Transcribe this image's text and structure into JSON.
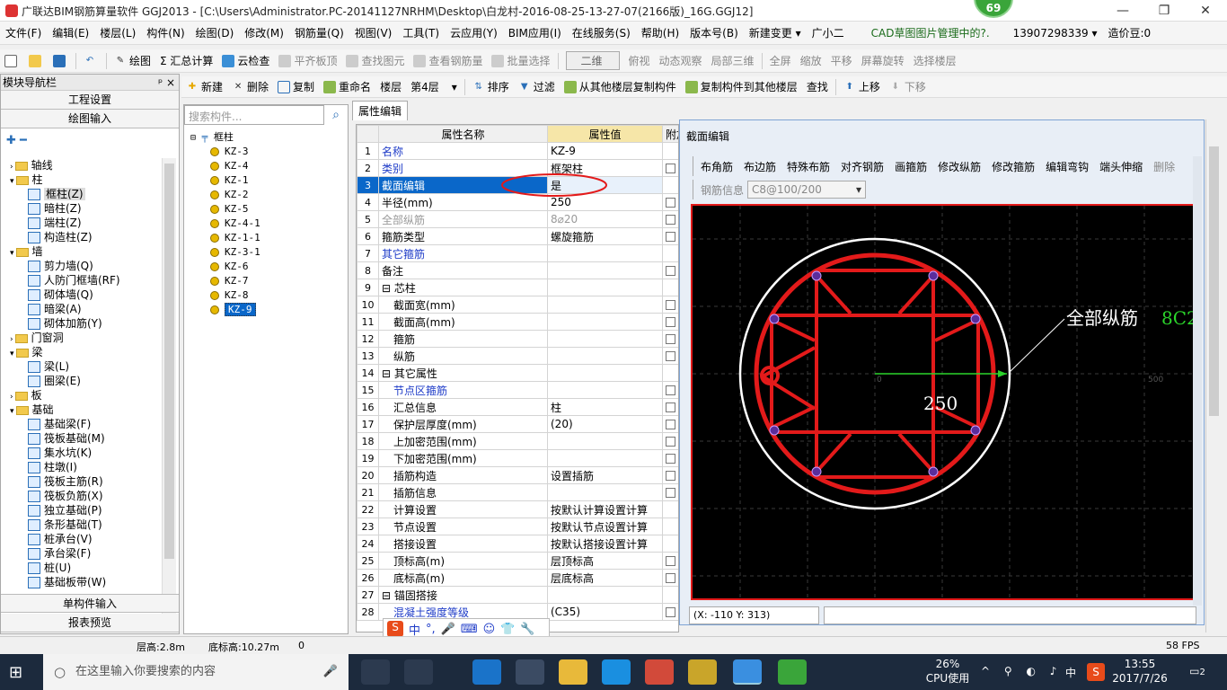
{
  "title_bar": {
    "text": "广联达BIM钢筋算量软件 GGJ2013 - [C:\\Users\\Administrator.PC-20141127NRHM\\Desktop\\白龙村-2016-08-25-13-27-07(2166版)_16G.GGJ12]",
    "badge": "69"
  },
  "menu": [
    "文件(F)",
    "编辑(E)",
    "楼层(L)",
    "构件(N)",
    "绘图(D)",
    "修改(M)",
    "钢筋量(Q)",
    "视图(V)",
    "工具(T)",
    "云应用(Y)",
    "BIM应用(I)",
    "在线服务(S)",
    "帮助(H)",
    "版本号(B)",
    "新建变更 ▾",
    "广小二",
    "CAD草图图片管理中的?.",
    "13907298339 ▾",
    "造价豆:0"
  ],
  "toolbar1": [
    "绘图",
    "Σ 汇总计算",
    "云检查",
    "平齐板顶",
    "查找图元",
    "查看钢筋量",
    "批量选择",
    "二维",
    "俯视",
    "动态观察",
    "局部三维",
    "全屏",
    "缩放",
    "平移",
    "屏幕旋转",
    "选择楼层"
  ],
  "toolbar2": [
    "新建",
    "删除",
    "复制",
    "重命名",
    "楼层",
    "第4层",
    "排序",
    "过滤",
    "从其他楼层复制构件",
    "复制构件到其他楼层",
    "查找",
    "上移",
    "下移"
  ],
  "nav": {
    "header": "模块导航栏",
    "top_buttons": [
      "工程设置",
      "绘图输入"
    ],
    "bottom_buttons": [
      "单构件输入",
      "报表预览"
    ],
    "tree": [
      {
        "label": "轴线",
        "type": "folder",
        "level": 0
      },
      {
        "label": "柱",
        "type": "folder",
        "level": 0
      },
      {
        "label": "框柱(Z)",
        "type": "item",
        "level": 1
      },
      {
        "label": "暗柱(Z)",
        "type": "item",
        "level": 1
      },
      {
        "label": "端柱(Z)",
        "type": "item",
        "level": 1
      },
      {
        "label": "构造柱(Z)",
        "type": "item",
        "level": 1
      },
      {
        "label": "墙",
        "type": "folder",
        "level": 0
      },
      {
        "label": "剪力墙(Q)",
        "type": "item",
        "level": 1
      },
      {
        "label": "人防门框墙(RF)",
        "type": "item",
        "level": 1
      },
      {
        "label": "砌体墙(Q)",
        "type": "item",
        "level": 1
      },
      {
        "label": "暗梁(A)",
        "type": "item",
        "level": 1
      },
      {
        "label": "砌体加筋(Y)",
        "type": "item",
        "level": 1
      },
      {
        "label": "门窗洞",
        "type": "folder",
        "level": 0
      },
      {
        "label": "梁",
        "type": "folder",
        "level": 0
      },
      {
        "label": "梁(L)",
        "type": "item",
        "level": 1
      },
      {
        "label": "圈梁(E)",
        "type": "item",
        "level": 1
      },
      {
        "label": "板",
        "type": "folder",
        "level": 0
      },
      {
        "label": "基础",
        "type": "folder",
        "level": 0
      },
      {
        "label": "基础梁(F)",
        "type": "item",
        "level": 1
      },
      {
        "label": "筏板基础(M)",
        "type": "item",
        "level": 1
      },
      {
        "label": "集水坑(K)",
        "type": "item",
        "level": 1
      },
      {
        "label": "柱墩(I)",
        "type": "item",
        "level": 1
      },
      {
        "label": "筏板主筋(R)",
        "type": "item",
        "level": 1
      },
      {
        "label": "筏板负筋(X)",
        "type": "item",
        "level": 1
      },
      {
        "label": "独立基础(P)",
        "type": "item",
        "level": 1
      },
      {
        "label": "条形基础(T)",
        "type": "item",
        "level": 1
      },
      {
        "label": "桩承台(V)",
        "type": "item",
        "level": 1
      },
      {
        "label": "承台梁(F)",
        "type": "item",
        "level": 1
      },
      {
        "label": "桩(U)",
        "type": "item",
        "level": 1
      },
      {
        "label": "基础板带(W)",
        "type": "item",
        "level": 1
      }
    ]
  },
  "components": {
    "search_placeholder": "搜索构件...",
    "root": "框柱",
    "items": [
      "KZ-3",
      "KZ-4",
      "KZ-1",
      "KZ-2",
      "KZ-5",
      "KZ-4-1",
      "KZ-1-1",
      "KZ-3-1",
      "KZ-6",
      "KZ-7",
      "KZ-8",
      "KZ-9"
    ],
    "selected": "KZ-9"
  },
  "props": {
    "tab": "属性编辑",
    "headers": [
      "属性名称",
      "属性值",
      "附加"
    ],
    "rows": [
      {
        "n": "1",
        "name": "名称",
        "val": "KZ-9",
        "style": "blue",
        "chk": false
      },
      {
        "n": "2",
        "name": "类别",
        "val": "框架柱",
        "style": "blue",
        "chk": true
      },
      {
        "n": "3",
        "name": "截面编辑",
        "val": "是",
        "style": "blue",
        "chk": false,
        "selected": true
      },
      {
        "n": "4",
        "name": "半径(mm)",
        "val": "250",
        "style": "",
        "chk": true
      },
      {
        "n": "5",
        "name": "全部纵筋",
        "val": "8⌀20",
        "style": "gray",
        "chk": true
      },
      {
        "n": "6",
        "name": "箍筋类型",
        "val": "螺旋箍筋",
        "style": "",
        "chk": true
      },
      {
        "n": "7",
        "name": "其它箍筋",
        "val": "",
        "style": "blue",
        "chk": false
      },
      {
        "n": "8",
        "name": "备注",
        "val": "",
        "style": "",
        "chk": true
      },
      {
        "n": "9",
        "name": "⊟ 芯柱",
        "val": "",
        "style": "",
        "chk": false
      },
      {
        "n": "10",
        "name": "截面宽(mm)",
        "val": "",
        "style": "",
        "chk": true,
        "indent": true
      },
      {
        "n": "11",
        "name": "截面高(mm)",
        "val": "",
        "style": "",
        "chk": true,
        "indent": true
      },
      {
        "n": "12",
        "name": "箍筋",
        "val": "",
        "style": "",
        "chk": true,
        "indent": true
      },
      {
        "n": "13",
        "name": "纵筋",
        "val": "",
        "style": "",
        "chk": true,
        "indent": true
      },
      {
        "n": "14",
        "name": "⊟ 其它属性",
        "val": "",
        "style": "",
        "chk": false
      },
      {
        "n": "15",
        "name": "节点区箍筋",
        "val": "",
        "style": "blue",
        "chk": true,
        "indent": true
      },
      {
        "n": "16",
        "name": "汇总信息",
        "val": "柱",
        "style": "",
        "chk": true,
        "indent": true
      },
      {
        "n": "17",
        "name": "保护层厚度(mm)",
        "val": "(20)",
        "style": "",
        "chk": true,
        "indent": true
      },
      {
        "n": "18",
        "name": "上加密范围(mm)",
        "val": "",
        "style": "",
        "chk": true,
        "indent": true
      },
      {
        "n": "19",
        "name": "下加密范围(mm)",
        "val": "",
        "style": "",
        "chk": true,
        "indent": true
      },
      {
        "n": "20",
        "name": "插筋构造",
        "val": "设置插筋",
        "style": "",
        "chk": true,
        "indent": true
      },
      {
        "n": "21",
        "name": "插筋信息",
        "val": "",
        "style": "",
        "chk": true,
        "indent": true
      },
      {
        "n": "22",
        "name": "计算设置",
        "val": "按默认计算设置计算",
        "style": "",
        "chk": false,
        "indent": true
      },
      {
        "n": "23",
        "name": "节点设置",
        "val": "按默认节点设置计算",
        "style": "",
        "chk": false,
        "indent": true
      },
      {
        "n": "24",
        "name": "搭接设置",
        "val": "按默认搭接设置计算",
        "style": "",
        "chk": false,
        "indent": true
      },
      {
        "n": "25",
        "name": "顶标高(m)",
        "val": "层顶标高",
        "style": "",
        "chk": true,
        "indent": true
      },
      {
        "n": "26",
        "name": "底标高(m)",
        "val": "层底标高",
        "style": "",
        "chk": true,
        "indent": true
      },
      {
        "n": "27",
        "name": "⊟ 锚固搭接",
        "val": "",
        "style": "",
        "chk": false
      },
      {
        "n": "28",
        "name": "混凝土强度等级",
        "val": "(C35)",
        "style": "blue",
        "chk": true,
        "indent": true
      }
    ]
  },
  "dialog": {
    "title": "截面编辑",
    "tools": [
      "布角筋",
      "布边筋",
      "特殊布筋",
      "对齐钢筋",
      "画箍筋",
      "修改纵筋",
      "修改箍筋",
      "编辑弯钩",
      "端头伸缩",
      "删除"
    ],
    "rebar_info_label": "钢筋信息",
    "rebar_info_value": "C8@100/200",
    "annotation": "全部纵筋",
    "annotation_value": "8C2",
    "radius_label": "250",
    "axis_0": "0",
    "axis_500": "500",
    "coord_text": "(X: -110 Y: 313)"
  },
  "status": {
    "floor_height": "层高:2.8m",
    "base_height": "底标高:10.27m",
    "zero": "0",
    "fps": "58 FPS"
  },
  "taskbar": {
    "search": "在这里输入你要搜索的内容",
    "cpu_pct": "26%",
    "cpu_label": "CPU使用",
    "lang": "中",
    "time": "13:55",
    "date": "2017/7/26",
    "notif": "2"
  }
}
